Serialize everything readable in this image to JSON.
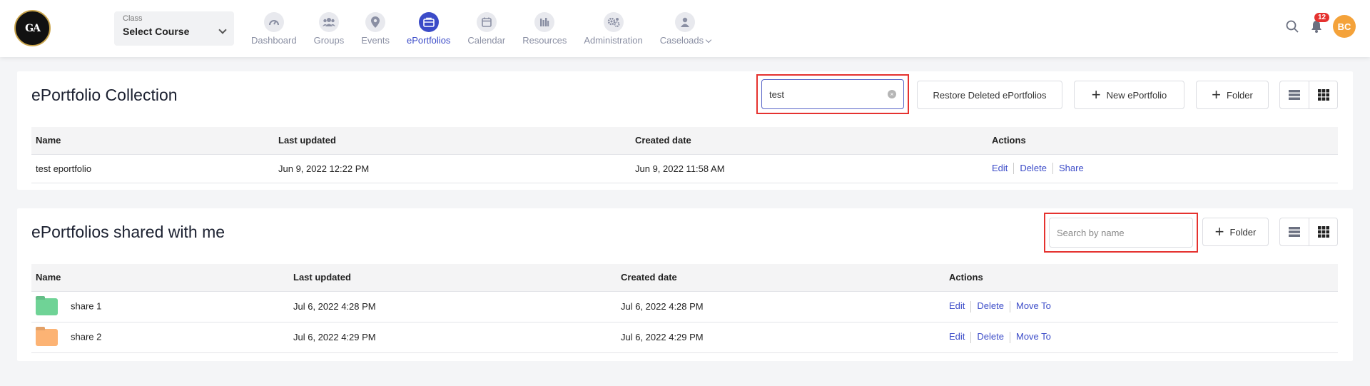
{
  "header": {
    "logo_text": "GA",
    "class_select": {
      "caption": "Class",
      "value": "Select Course"
    },
    "nav": [
      {
        "label": "Dashboard",
        "icon": "speedometer-icon"
      },
      {
        "label": "Groups",
        "icon": "users-icon"
      },
      {
        "label": "Events",
        "icon": "location-pin-icon"
      },
      {
        "label": "ePortfolios",
        "icon": "briefcase-icon",
        "active": true
      },
      {
        "label": "Calendar",
        "icon": "calendar-icon"
      },
      {
        "label": "Resources",
        "icon": "books-icon"
      },
      {
        "label": "Administration",
        "icon": "gears-icon"
      },
      {
        "label": "Caseloads",
        "icon": "person-icon"
      }
    ],
    "notification_count": "12",
    "avatar_initials": "BC",
    "accent_color": "#3b4bc8",
    "avatar_color": "#f4a23a",
    "badge_color": "#e5322f"
  },
  "collection": {
    "title": "ePortfolio Collection",
    "search": {
      "value": "test",
      "placeholder": ""
    },
    "restore_label": "Restore Deleted ePortfolios",
    "new_label": "New ePortfolio",
    "folder_label": "Folder",
    "columns": [
      "Name",
      "Last updated",
      "Created date",
      "Actions"
    ],
    "rows": [
      {
        "name": "test eportfolio",
        "updated": "Jun 9, 2022 12:22 PM",
        "created": "Jun 9, 2022 11:58 AM",
        "actions": [
          "Edit",
          "Delete",
          "Share"
        ]
      }
    ]
  },
  "shared": {
    "title": "ePortfolios shared with me",
    "search": {
      "value": "",
      "placeholder": "Search by name"
    },
    "folder_label": "Folder",
    "columns": [
      "Name",
      "Last updated",
      "Created date",
      "Actions"
    ],
    "rows": [
      {
        "name": "share 1",
        "folder_color": "#6fd396",
        "updated": "Jul 6, 2022 4:28 PM",
        "created": "Jul 6, 2022 4:28 PM",
        "actions": [
          "Edit",
          "Delete",
          "Move To"
        ]
      },
      {
        "name": "share 2",
        "folder_color": "#fcb374",
        "updated": "Jul 6, 2022 4:29 PM",
        "created": "Jul 6, 2022 4:29 PM",
        "actions": [
          "Edit",
          "Delete",
          "Move To"
        ]
      }
    ]
  }
}
